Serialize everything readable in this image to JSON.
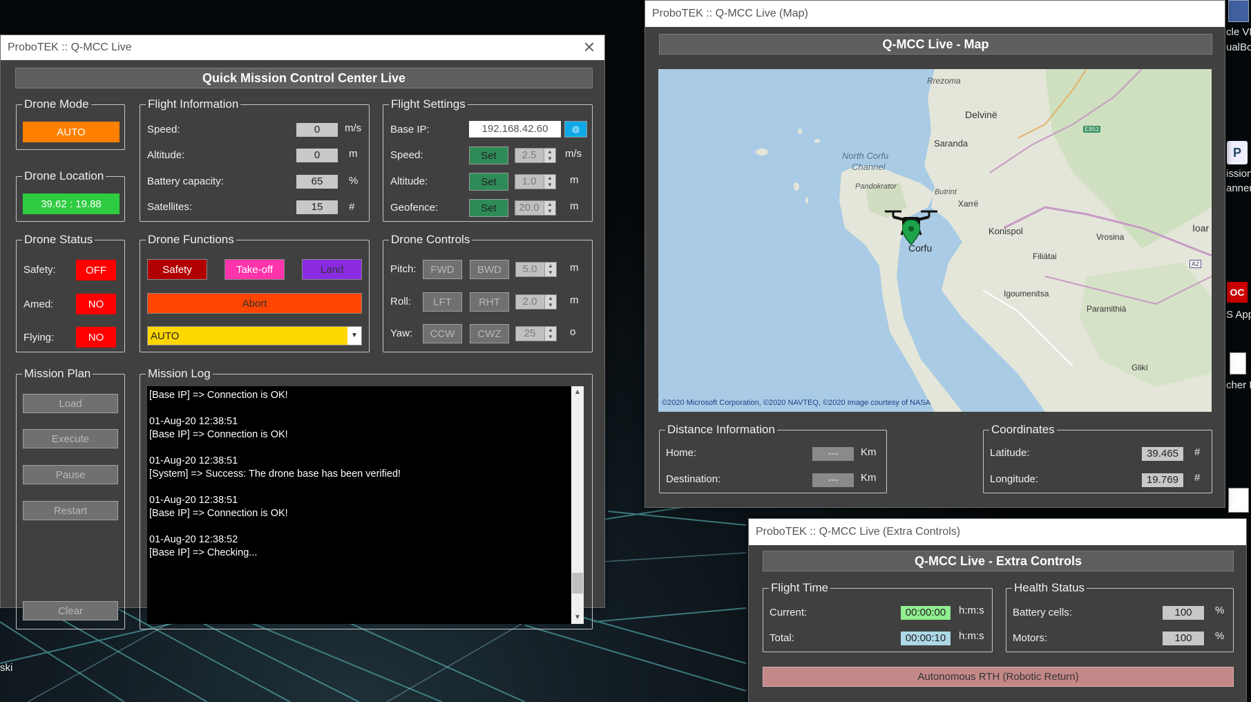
{
  "main_window": {
    "title": "ProboTEK :: Q-MCC Live",
    "close_icon": "close-icon",
    "banner": "Quick Mission Control Center Live",
    "drone_mode": {
      "legend": "Drone Mode",
      "value": "AUTO"
    },
    "drone_location": {
      "legend": "Drone Location",
      "value": "39.62 : 19.88"
    },
    "flight_info": {
      "legend": "Flight Information",
      "rows": [
        {
          "label": "Speed:",
          "value": "0",
          "unit": "m/s"
        },
        {
          "label": "Altitude:",
          "value": "0",
          "unit": "m"
        },
        {
          "label": "Battery capacity:",
          "value": "65",
          "unit": "%"
        },
        {
          "label": "Satellites:",
          "value": "15",
          "unit": "#"
        }
      ]
    },
    "flight_settings": {
      "legend": "Flight Settings",
      "base_ip_label": "Base IP:",
      "base_ip_value": "192.168.42.60",
      "base_ip_button_icon": "globe-icon",
      "set_label": "Set",
      "rows": [
        {
          "label": "Speed:",
          "value": "2.5",
          "unit": "m/s"
        },
        {
          "label": "Altitude:",
          "value": "1.0",
          "unit": "m"
        },
        {
          "label": "Geofence:",
          "value": "20.0",
          "unit": "m"
        }
      ]
    },
    "drone_status": {
      "legend": "Drone Status",
      "rows": [
        {
          "label": "Safety:",
          "value": "OFF"
        },
        {
          "label": "Amed:",
          "value": "NO"
        },
        {
          "label": "Flying:",
          "value": "NO"
        }
      ]
    },
    "drone_functions": {
      "legend": "Drone Functions",
      "safety": "Safety",
      "takeoff": "Take-off",
      "land": "Land",
      "abort": "Abort",
      "mode_select": "AUTO"
    },
    "drone_controls": {
      "legend": "Drone Controls",
      "rows": [
        {
          "label": "Pitch:",
          "b1": "FWD",
          "b2": "BWD",
          "value": "5.0",
          "unit": "m"
        },
        {
          "label": "Roll:",
          "b1": "LFT",
          "b2": "RHT",
          "value": "2.0",
          "unit": "m"
        },
        {
          "label": "Yaw:",
          "b1": "CCW",
          "b2": "CWZ",
          "value": "25",
          "unit": "o"
        }
      ]
    },
    "mission_plan": {
      "legend": "Mission Plan",
      "load": "Load",
      "execute": "Execute",
      "pause": "Pause",
      "restart": "Restart",
      "clear": "Clear"
    },
    "mission_log": {
      "legend": "Mission Log",
      "lines": [
        "[Base IP] => Connection is OK!",
        "",
        "01-Aug-20 12:38:51",
        "[Base IP] => Connection is OK!",
        "",
        "01-Aug-20 12:38:51",
        "[System] => Success: The drone base has been verified!",
        "",
        "01-Aug-20 12:38:51",
        "[Base IP] => Connection is OK!",
        "",
        "01-Aug-20 12:38:52",
        "[Base IP] => Checking..."
      ]
    }
  },
  "map_window": {
    "title": "ProboTEK :: Q-MCC Live (Map)",
    "banner": "Q-MCC Live - Map",
    "map_labels": {
      "rrezoma": "Rrezoma",
      "delvine": "Delvinë",
      "saranda": "Saranda",
      "e853": "E853",
      "north_corfu": "North Corfu",
      "channel": "Channel",
      "pandokrator": "Pandokrator",
      "butrint": "Butrint",
      "xarre": "Xarrë",
      "konispol": "Konispol",
      "vrosina": "Vrosina",
      "ioar": "Ioar",
      "filiatai": "Filiátai",
      "corfu": "Corfu",
      "a2": "A2",
      "igoumenitsa": "Igoumenitsa",
      "paramithia": "Paramithiá",
      "gliki": "Glikí"
    },
    "copyright": "©2020 Microsoft Corporation, ©2020 NAVTEQ, ©2020 Image courtesy of NASA",
    "drone_icon": "drone-icon",
    "marker_icon": "map-pin-icon",
    "distance": {
      "legend": "Distance Information",
      "rows": [
        {
          "label": "Home:",
          "value": "---",
          "unit": "Km"
        },
        {
          "label": "Destination:",
          "value": "---",
          "unit": "Km"
        }
      ]
    },
    "coordinates": {
      "legend": "Coordinates",
      "rows": [
        {
          "label": "Latitude:",
          "value": "39.465",
          "unit": "#"
        },
        {
          "label": "Longitude:",
          "value": "19.769",
          "unit": "#"
        }
      ]
    }
  },
  "extra_window": {
    "title": "ProboTEK :: Q-MCC Live (Extra Controls)",
    "banner": "Q-MCC Live - Extra Controls",
    "flight_time": {
      "legend": "Flight Time",
      "rows": [
        {
          "label": "Current:",
          "value": "00:00:00",
          "unit": "h:m:s"
        },
        {
          "label": "Total:",
          "value": "00:00:10",
          "unit": "h:m:s"
        }
      ]
    },
    "health": {
      "legend": "Health Status",
      "rows": [
        {
          "label": "Battery cells:",
          "value": "100",
          "unit": "%"
        },
        {
          "label": "Motors:",
          "value": "100",
          "unit": "%"
        }
      ]
    },
    "rth_button": "Autonomous RTH (Robotic Return)"
  },
  "desktop": {
    "texts": [
      "cle VM",
      "ualBo",
      "ission",
      "anner",
      "Ioar",
      "S App",
      "cher I",
      "ski"
    ]
  },
  "colors": {
    "window_bg": "#404040",
    "banner_bg": "#5e5e5e",
    "mode_orange": "#ff8000",
    "location_green": "#2ecc40",
    "status_red": "#ff0000",
    "safety_red": "#b10000",
    "takeoff_pink": "#ff33aa",
    "land_purple": "#8a2be2",
    "abort_orange": "#ff4500",
    "select_yellow": "#ffd700",
    "set_green": "#2e8b57",
    "rth_pink": "#c48888"
  }
}
